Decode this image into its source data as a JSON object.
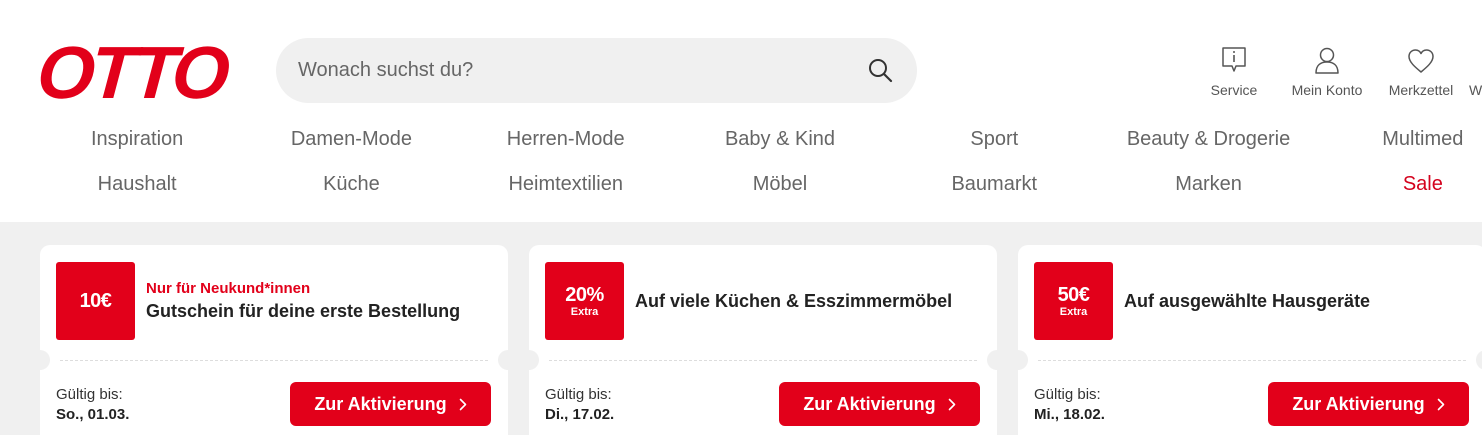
{
  "brand": {
    "logo_text": "OTTO",
    "accent_color": "#e2001a"
  },
  "search": {
    "placeholder": "Wonach suchst du?",
    "icon": "search-icon"
  },
  "header_actions": [
    {
      "label": "Service",
      "icon": "info-bubble-icon"
    },
    {
      "label": "Mein Konto",
      "icon": "user-icon"
    },
    {
      "label": "Merkzettel",
      "icon": "heart-icon"
    },
    {
      "label": "Wa",
      "icon": "cart-icon"
    }
  ],
  "nav": {
    "row1": [
      "Inspiration",
      "Damen-Mode",
      "Herren-Mode",
      "Baby & Kind",
      "Sport",
      "Beauty & Drogerie",
      "Multimed"
    ],
    "row2": [
      "Haushalt",
      "Küche",
      "Heimtextilien",
      "Möbel",
      "Baumarkt",
      "Marken",
      "Sale"
    ]
  },
  "coupons": [
    {
      "badge_main": "10€",
      "badge_sub": "",
      "eyebrow": "Nur für Neukund*innen",
      "title": "Gutschein für deine erste Bestellung",
      "valid_label": "Gültig bis:",
      "valid_date": "So., 01.03.",
      "cta": "Zur Aktivierung"
    },
    {
      "badge_main": "20%",
      "badge_sub": "Extra",
      "eyebrow": "",
      "title": "Auf viele Küchen & Esszimmermöbel",
      "valid_label": "Gültig bis:",
      "valid_date": "Di., 17.02.",
      "cta": "Zur Aktivierung"
    },
    {
      "badge_main": "50€",
      "badge_sub": "Extra",
      "eyebrow": "",
      "title": "Auf ausgewählte Hausgeräte",
      "valid_label": "Gültig bis:",
      "valid_date": "Mi., 18.02.",
      "cta": "Zur Aktivierung"
    }
  ]
}
